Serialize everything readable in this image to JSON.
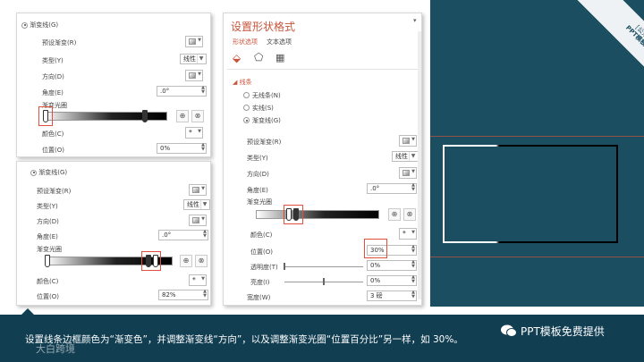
{
  "panel_top": {
    "section_label": "渐变线(G)",
    "preset": "预设渐变(R)",
    "type": "类型(Y)",
    "type_value": "线性",
    "direction": "方向(D)",
    "angle": "角度(E)",
    "angle_value": ".0°",
    "stops": "渐变光圈",
    "color": "颜色(C)",
    "position": "位置(O)",
    "position_value": "0%"
  },
  "panel_mid": {
    "section_label": "渐变线(G)",
    "preset": "预设渐变(R)",
    "type": "类型(Y)",
    "type_value": "线性",
    "direction": "方向(D)",
    "angle": "角度(E)",
    "angle_value": ".0°",
    "stops": "渐变光圈",
    "color": "颜色(C)",
    "position": "位置(O)",
    "position_value": "82%"
  },
  "panel_right": {
    "title": "设置形状格式",
    "tab_shape": "形状选项",
    "tab_text": "文本选项",
    "section": "线条",
    "opt_none": "无线条(N)",
    "opt_solid": "实线(S)",
    "opt_gradient": "渐变线(G)",
    "preset": "预设渐变(R)",
    "type": "类型(Y)",
    "type_value": "线性",
    "direction": "方向(D)",
    "angle": "角度(E)",
    "angle_value": ".0°",
    "stops": "渐变光圈",
    "color": "颜色(C)",
    "position": "位置(O)",
    "position_value": "30%",
    "transparency": "透明度(T)",
    "transparency_value": "0%",
    "brightness": "亮度(I)",
    "brightness_value": "0%",
    "width": "宽度(W)",
    "width_value": "3 磅"
  },
  "preview": {
    "ribbon_line1": "[公众号]",
    "ribbon_line2": "PPT模板免费提供"
  },
  "footer": {
    "caption": "设置线条边框颜色为“渐变色”，并调整渐变线“方向”，以及调整渐变光圈“位置百分比”另一样，如 30%。",
    "brand": "PPT模板免费提供",
    "watermark": "大白跨境"
  },
  "colors": {
    "teal": "#1c4e61",
    "accent": "#e0503a",
    "footer_bg": "#123e52"
  }
}
